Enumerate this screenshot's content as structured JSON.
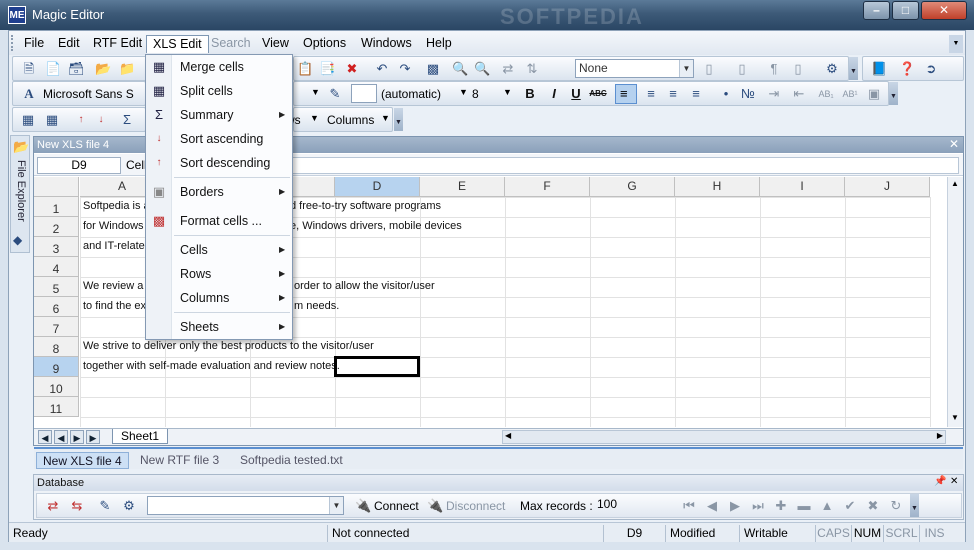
{
  "window": {
    "title": "Magic Editor",
    "icon_text": "ME",
    "watermark": "SOFTPEDIA"
  },
  "menubar": [
    {
      "label": "File"
    },
    {
      "label": "Edit"
    },
    {
      "label": "RTF Edit"
    },
    {
      "label": "XLS Edit"
    },
    {
      "label": "Search"
    },
    {
      "label": "View"
    },
    {
      "label": "Options"
    },
    {
      "label": "Windows"
    },
    {
      "label": "Help"
    }
  ],
  "toolbar": {
    "style_combo": "None",
    "font_name": "Microsoft Sans S",
    "font_color": "(automatic)",
    "font_size": "8",
    "bold": "B",
    "italic": "I",
    "underline": "U",
    "strike": "ABC",
    "rows_label": "ws",
    "columns_label": "Columns",
    "fmt_ab1": "AB₁",
    "fmt_ab2": "AB¹"
  },
  "side_panel": {
    "label": "File Explorer"
  },
  "document": {
    "title": "New XLS file 4",
    "cell_ref": "D9",
    "cell_label": "Cell",
    "columns": [
      "A",
      "D",
      "E",
      "F",
      "G",
      "H",
      "I",
      "J"
    ],
    "rows": [
      "1",
      "2",
      "3",
      "4",
      "5",
      "6",
      "7",
      "8",
      "9",
      "10",
      "11"
    ],
    "cells": {
      "r1a": "Softpedia is a",
      "r1b": "d free-to-try software programs",
      "r2a": "for Windows",
      "r2b": "e, Windows drivers, mobile devices",
      "r3a": "and IT-relate",
      "r5a": "We review a",
      "r5b": "order to allow the visitor/user",
      "r6a": "to find the ex",
      "r6b": "m needs.",
      "r8": "We strive to deliver only the best products to the visitor/user",
      "r9": "together with self-made evaluation and review notes."
    },
    "sheet_tab": "Sheet1"
  },
  "doc_tabs": [
    {
      "label": "New XLS file 4"
    },
    {
      "label": "New RTF file 3"
    },
    {
      "label": "Softpedia tested.txt"
    }
  ],
  "xls_menu": [
    {
      "label": "Merge cells"
    },
    {
      "label": "Split cells"
    },
    {
      "label": "Summary"
    },
    {
      "label": "Sort ascending"
    },
    {
      "label": "Sort descending"
    },
    {
      "label": "Borders"
    },
    {
      "label": "Format cells ..."
    },
    {
      "label": "Cells"
    },
    {
      "label": "Rows"
    },
    {
      "label": "Columns"
    },
    {
      "label": "Sheets"
    }
  ],
  "database": {
    "title": "Database",
    "connect": "Connect",
    "disconnect": "Disconnect",
    "max_records_label": "Max records :",
    "max_records_value": "100"
  },
  "statusbar": {
    "ready": "Ready",
    "connection": "Not connected",
    "cell": "D9",
    "modified": "Modified",
    "writable": "Writable",
    "caps": "CAPS",
    "num": "NUM",
    "scrl": "SCRL",
    "ins": "INS"
  }
}
